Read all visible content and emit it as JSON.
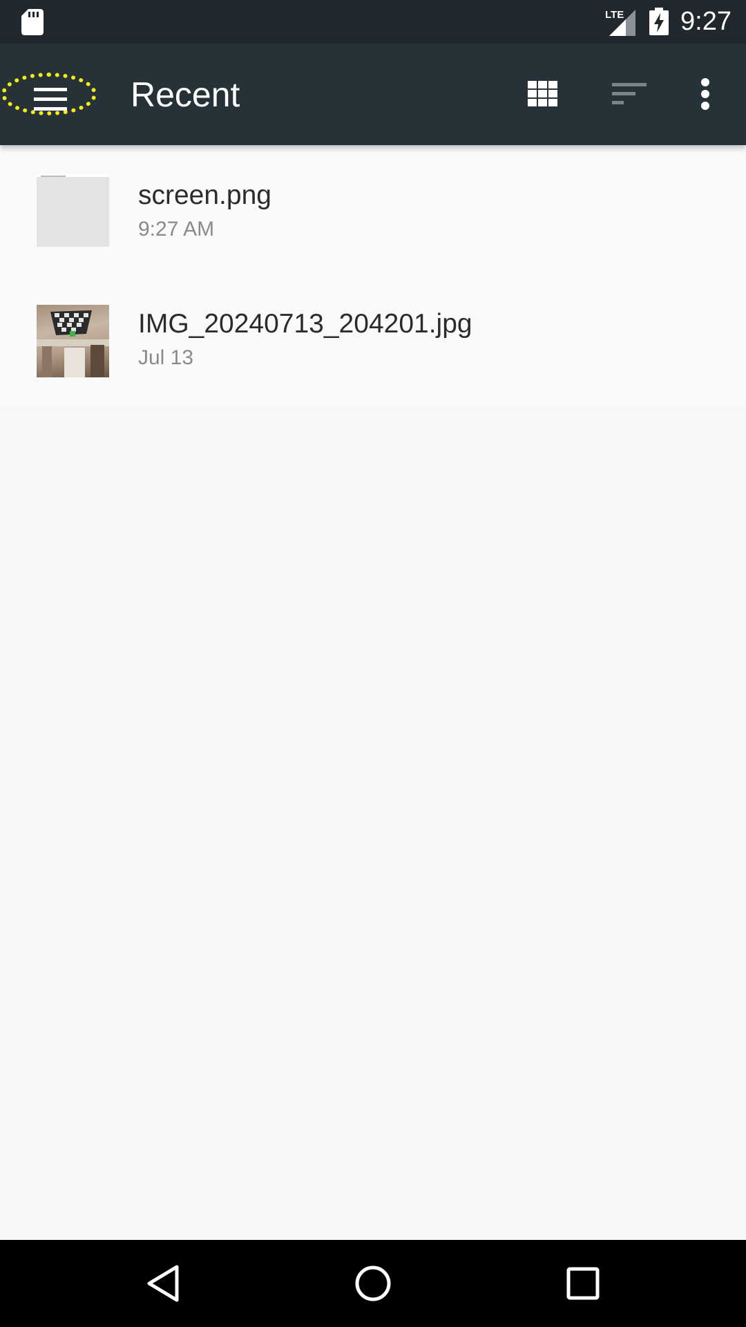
{
  "status_bar": {
    "time": "9:27",
    "network": "LTE",
    "icons": [
      "sd-card-icon",
      "lte-signal-icon",
      "battery-charging-icon"
    ]
  },
  "toolbar": {
    "title": "Recent",
    "menu_icon": "hamburger-menu-icon",
    "actions": [
      "grid-view-icon",
      "sort-icon",
      "more-options-icon"
    ],
    "menu_highlight_color": "#f2ec17",
    "background_color": "#263238"
  },
  "files": [
    {
      "name": "screen.png",
      "date": "9:27 AM",
      "thumbnail": "screenshot-thumbnail"
    },
    {
      "name": "IMG_20240713_204201.jpg",
      "date": "Jul 13",
      "thumbnail": "photo-thumbnail"
    }
  ],
  "nav_bar": {
    "buttons": [
      "back-icon",
      "home-icon",
      "recents-icon"
    ]
  }
}
